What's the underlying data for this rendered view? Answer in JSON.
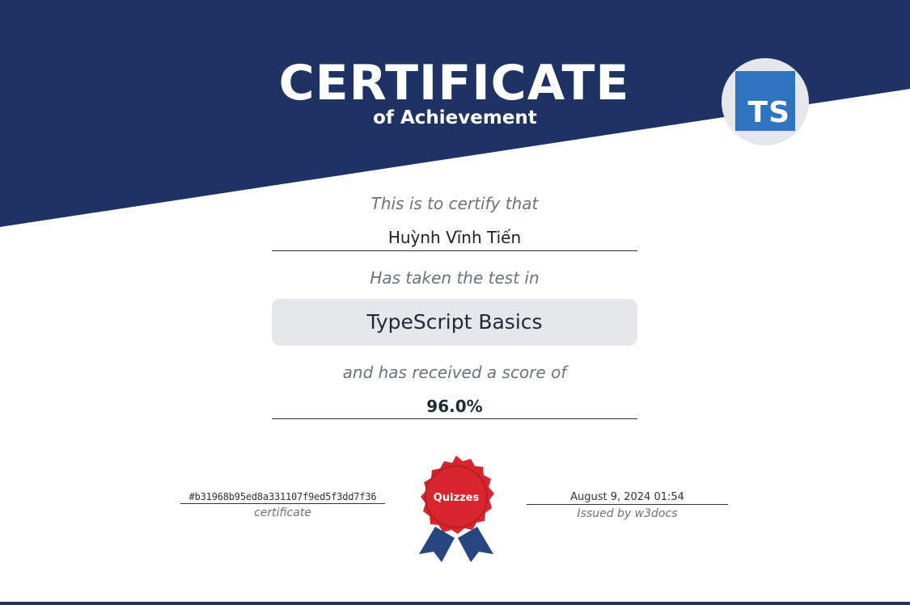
{
  "certificate": {
    "title": "CERTIFICATE",
    "subtitle": "of Achievement",
    "badge_text": "TS",
    "certify_text": "This is to certify that",
    "recipient_name": "Huỳnh Vĩnh Tiến",
    "taken_test_text": "Has taken the test in",
    "test_name": "TypeScript Basics",
    "score_text": "and has received a score of",
    "score": "96.0%",
    "hash": "#b31968b95ed8a331107f9ed5f3dd7f36",
    "hash_caption": "certificate",
    "date": "August 9, 2024 01:54",
    "issuer": "Issued by w3docs",
    "seal_label": "Quizzes"
  },
  "colors": {
    "navy": "#1e3263",
    "ts_blue": "#2f74c0",
    "seal_red": "#d7262e",
    "ribbon_blue": "#27467f",
    "muted_gray": "#6b7280",
    "box_gray": "#e5e7eb"
  }
}
